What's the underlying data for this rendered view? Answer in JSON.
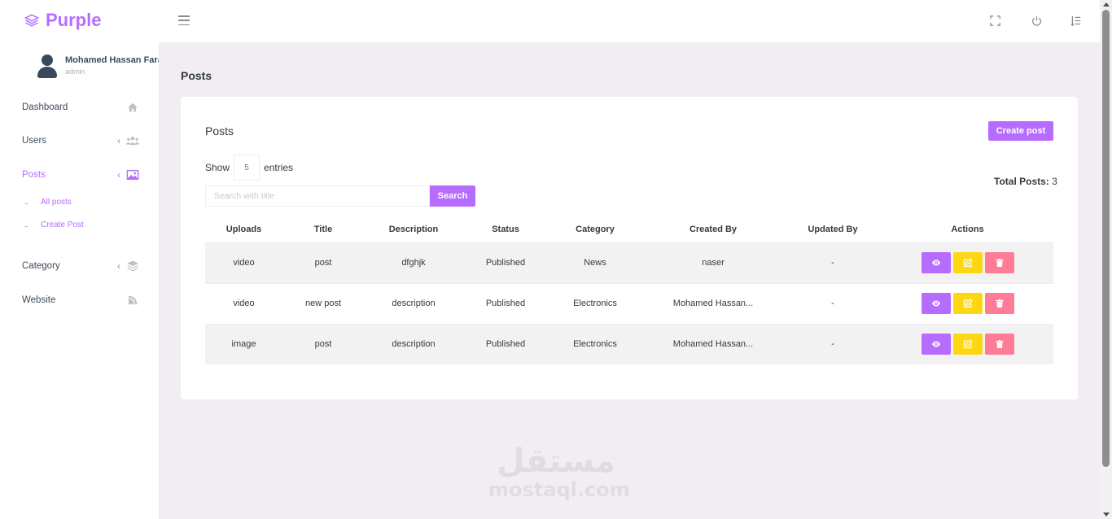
{
  "brand": {
    "name": "Purple",
    "icon": "layers-icon",
    "color": "#b66dff"
  },
  "profile": {
    "name": "Mohamed Hassan Farag",
    "role": "admin"
  },
  "sidebar": {
    "items": [
      {
        "label": "Dashboard",
        "icon": "home-icon"
      },
      {
        "label": "Users",
        "icon": "users-icon"
      },
      {
        "label": "Posts",
        "icon": "image-icon",
        "active": true
      },
      {
        "label": "Category",
        "icon": "layers-icon"
      },
      {
        "label": "Website",
        "icon": "feed-icon"
      }
    ],
    "submenu": [
      {
        "label": "All posts"
      },
      {
        "label": "Create Post"
      }
    ]
  },
  "topbar": {
    "icons": [
      "menu-icon",
      "fullscreen-icon",
      "power-icon",
      "list-icon"
    ]
  },
  "page": {
    "title": "Posts"
  },
  "card": {
    "title": "Posts",
    "create_label": "Create post",
    "show_label": "Show",
    "entries_value": "5",
    "entries_label": "entries",
    "total_label": "Total Posts:",
    "total_value": "3",
    "search_placeholder": "Search with title",
    "search_label": "Search"
  },
  "table": {
    "headers": [
      "Uploads",
      "Title",
      "Description",
      "Status",
      "Category",
      "Created By",
      "Updated By",
      "Actions"
    ],
    "rows": [
      [
        "video",
        "post",
        "dfghjk",
        "Published",
        "News",
        "naser",
        "-"
      ],
      [
        "video",
        "new post",
        "description",
        "Published",
        "Electronics",
        "Mohamed Hassan...",
        "-"
      ],
      [
        "image",
        "post",
        "description",
        "Published",
        "Electronics",
        "Mohamed Hassan...",
        "-"
      ]
    ],
    "action_icons": [
      "eye-icon",
      "edit-icon",
      "trash-icon"
    ]
  },
  "colors": {
    "accent": "#b66dff",
    "warning": "#fed713",
    "danger": "#fe7c96",
    "background": "#f2edf3"
  },
  "watermark": {
    "arabic": "مستقل",
    "latin": "mostaql.com"
  }
}
